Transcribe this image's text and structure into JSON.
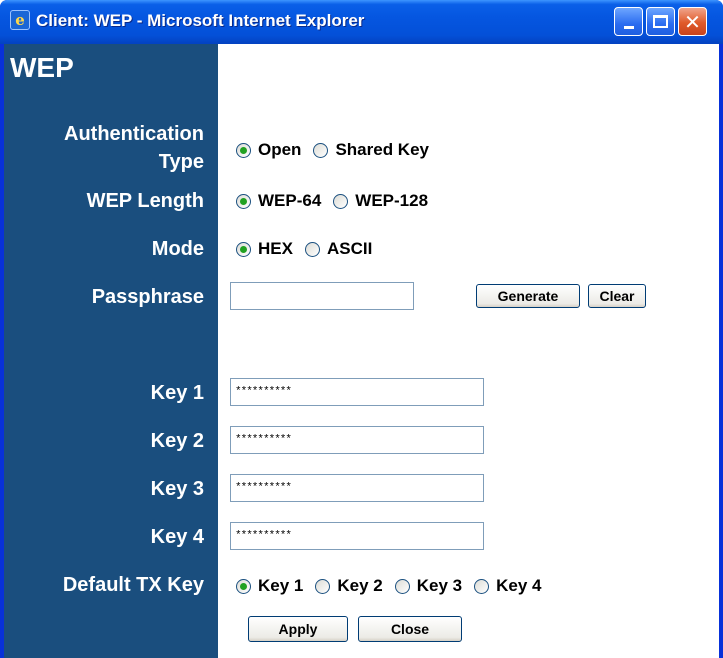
{
  "window": {
    "title": "Client: WEP - Microsoft Internet Explorer"
  },
  "page": {
    "title": "WEP"
  },
  "labels": {
    "auth_type_line1": "Authentication",
    "auth_type_line2": "Type",
    "wep_length": "WEP Length",
    "mode": "Mode",
    "passphrase": "Passphrase",
    "key1": "Key 1",
    "key2": "Key 2",
    "key3": "Key 3",
    "key4": "Key 4",
    "default_tx_key": "Default TX Key"
  },
  "auth_type": {
    "options": [
      "Open",
      "Shared Key"
    ],
    "selected": "Open"
  },
  "wep_length": {
    "options": [
      "WEP-64",
      "WEP-128"
    ],
    "selected": "WEP-64"
  },
  "mode": {
    "options": [
      "HEX",
      "ASCII"
    ],
    "selected": "HEX"
  },
  "passphrase": {
    "value": ""
  },
  "keys": {
    "key1": "**********",
    "key2": "**********",
    "key3": "**********",
    "key4": "**********"
  },
  "default_tx_key": {
    "options": [
      "Key 1",
      "Key 2",
      "Key 3",
      "Key 4"
    ],
    "selected": "Key 1"
  },
  "buttons": {
    "generate": "Generate",
    "clear": "Clear",
    "apply": "Apply",
    "close": "Close"
  },
  "colors": {
    "sidebar": "#1a4e7e",
    "titlebar": "#0556e0",
    "radio_dot": "#21a121"
  }
}
